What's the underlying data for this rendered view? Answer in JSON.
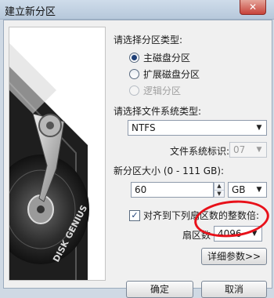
{
  "window": {
    "title": "建立新分区",
    "close_glyph": "✕"
  },
  "partition_type": {
    "label": "请选择分区类型:",
    "options": [
      {
        "label": "主磁盘分区",
        "checked": true,
        "disabled": false
      },
      {
        "label": "扩展磁盘分区",
        "checked": false,
        "disabled": false
      },
      {
        "label": "逻辑分区",
        "checked": false,
        "disabled": true
      }
    ]
  },
  "filesystem": {
    "label": "请选择文件系统类型:",
    "value": "NTFS",
    "id_label": "文件系统标识:",
    "id_value": "07"
  },
  "size": {
    "label": "新分区大小 (0 - 111 GB):",
    "value": "60",
    "unit": "GB"
  },
  "align": {
    "label": "对齐到下列扇区数的整数倍:",
    "checked": true,
    "sectors_label": "扇区数",
    "sectors_value": "4096"
  },
  "buttons": {
    "advanced": "详细参数>>",
    "ok": "确定",
    "cancel": "取消"
  },
  "illustration": {
    "brand_text": "DISK GENIUS"
  },
  "colors": {
    "annotation": "#e8111a",
    "selection": "#1e3f77"
  }
}
